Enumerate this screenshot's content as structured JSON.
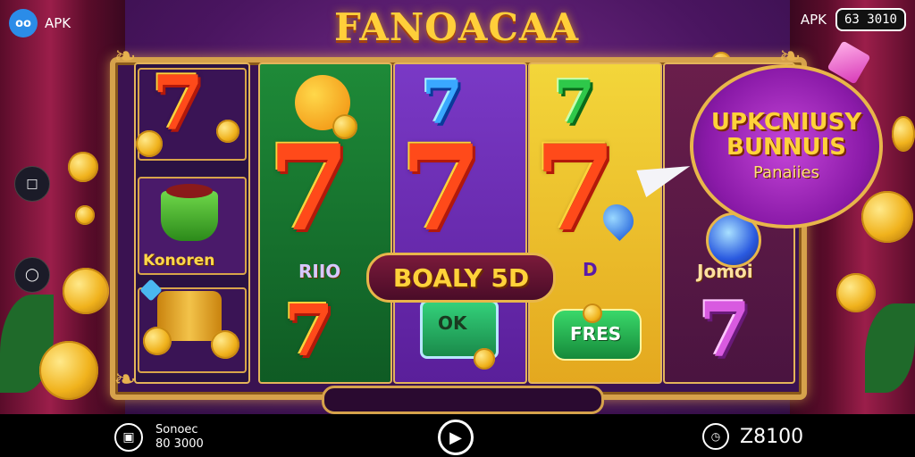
{
  "header": {
    "apk_label_left": "APK",
    "logo_text": "oo",
    "apk_label_right": "APK",
    "balance": "63 3010"
  },
  "game": {
    "title": "FANOACAA",
    "reel1": {
      "tile2_label": "Konoren"
    },
    "reel2_label": "RIIO",
    "reel4_label": "D",
    "reel4_tile_label": "FRES",
    "reel3_tile_label": "OK",
    "reel5_label": "Jomoi",
    "banner": "BOALY 5D",
    "bonus": {
      "line1": "UPKCNIUSY",
      "line2": "BUNNUIS",
      "line3": "Panaiies"
    }
  },
  "footer": {
    "label": "Sonoec",
    "amount": "80 3000",
    "total": "Z8100"
  },
  "colors": {
    "gold": "#ffd23a",
    "frame": "#d6a24b",
    "accent_blue": "#2b8ce8"
  },
  "icons": [
    "apk-logo-icon",
    "back-icon",
    "share-icon",
    "wallet-icon",
    "play-icon",
    "clock-icon"
  ]
}
